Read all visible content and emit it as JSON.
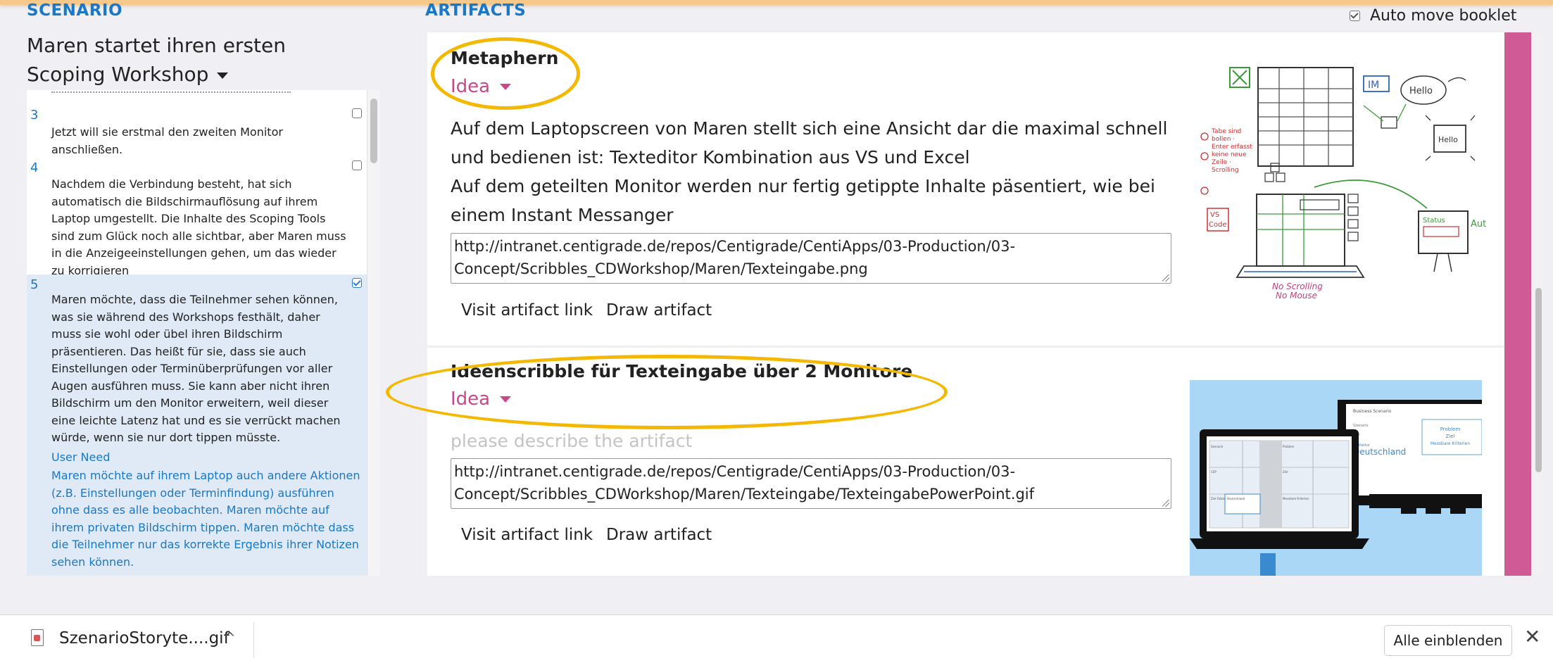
{
  "scenario": {
    "heading": "SCENARIO",
    "title": "Maren startet ihren ersten Scoping Workshop",
    "steps": [
      {
        "num": "3",
        "text": "Jetzt will sie erstmal den zweiten Monitor anschließen.",
        "checked": false
      },
      {
        "num": "4",
        "text": "Nachdem die Verbindung besteht, hat sich automatisch die Bildschirmauflösung auf ihrem Laptop umgestellt. Die Inhalte des Scoping Tools sind zum Glück noch alle sichtbar, aber Maren muss in die Anzeigeeinstellungen gehen, um das wieder zu korrigieren",
        "checked": false
      },
      {
        "num": "5",
        "text": "Maren möchte, dass die Teilnehmer sehen können, was sie während des Workshops festhält, daher muss sie wohl oder übel ihren Bildschirm präsentieren. Das heißt für sie, dass sie auch Einstellungen oder Terminüberprüfungen vor aller Augen ausführen muss. Sie kann aber nicht ihren Bildschirm um den Monitor erweitern, weil dieser eine leichte Latenz hat und es sie verrückt machen würde, wenn sie nur dort tippen müsste.",
        "checked": true,
        "need_label": "User Need",
        "need_text": "Maren möchte auf ihrem Laptop auch andere Aktionen (z.B. Einstellungen oder Terminfindung) ausführen ohne dass es alle beobachten. Maren möchte auf ihrem privaten Bildschirm tippen. Maren möchte dass die Teilnehmer nur das korrekte Ergebnis ihrer Notizen sehen können."
      }
    ]
  },
  "artifacts": {
    "heading": "ARTIFACTS",
    "auto_move_label": "Auto move booklet",
    "items": [
      {
        "title": "Metaphern",
        "type": "Idea",
        "description": "Auf dem Laptopscreen von Maren stellt sich eine Ansicht dar die maximal schnell und bedienen ist: Texteditor Kombination aus VS und Excel\nAuf dem geteilten Monitor werden nur fertig getippte Inhalte päsentiert, wie bei einem Instant Messanger",
        "url": "http://intranet.centigrade.de/repos/Centigrade/CentiApps/03-Production/03-Concept/Scribbles_CDWorkshop/Maren/Texteingabe.png",
        "visit_label": "Visit artifact link",
        "draw_label": "Draw artifact",
        "sketch": {
          "im": "IM",
          "hello": "Hello",
          "hello2": "Hello",
          "notes": "Tabe sind bollen · Enter erfasst keine neue Zeile · Scrolling",
          "vs": "VS",
          "code": "Code",
          "no_scroll": "No Scrolling",
          "no_mouse": "No Mouse",
          "status": "Status",
          "aut": "Aut"
        }
      },
      {
        "title": "Ideenscribble für Texteingabe über 2 Monitore",
        "type": "Idea",
        "description_placeholder": "please describe the artifact",
        "url": "http://intranet.centigrade.de/repos/Centigrade/CentiApps/03-Production/03-Concept/Scribbles_CDWorkshop/Maren/Texteingabe/TexteingabePowerPoint.gif",
        "visit_label": "Visit artifact link",
        "draw_label": "Draw artifact",
        "mock": {
          "monitor_header": "Business Scenario",
          "monitor_labels": [
            "Szenario",
            "CSP",
            "Zielfaktor"
          ],
          "monitor_value": "Deutschland",
          "box_lines": [
            "Problem",
            "Ziel",
            "Messbare Kriterien"
          ],
          "laptop_cells": [
            "Szenario",
            "Problem",
            "CSP",
            "Ziel",
            "Ziel Faktor",
            "Deutschland",
            "Messbare Kriterien"
          ]
        }
      }
    ]
  },
  "downloads": {
    "file_name": "SzenarioStoryte....gif",
    "show_all_label": "Alle einblenden",
    "close_glyph": "✕",
    "chevron_glyph": "^"
  }
}
